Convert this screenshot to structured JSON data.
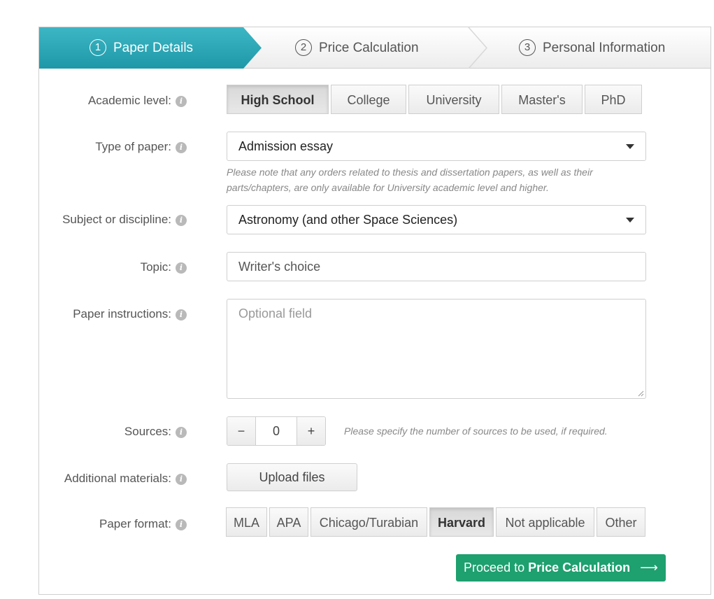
{
  "steps": [
    {
      "num": "1",
      "label": "Paper Details"
    },
    {
      "num": "2",
      "label": "Price Calculation"
    },
    {
      "num": "3",
      "label": "Personal Information"
    }
  ],
  "colors": {
    "active_step": "#29a8b7",
    "primary_button": "#1ea06f"
  },
  "form": {
    "academic_level": {
      "label": "Academic level:",
      "options": [
        "High School",
        "College",
        "University",
        "Master's",
        "PhD"
      ],
      "selected": "High School"
    },
    "type_of_paper": {
      "label": "Type of paper:",
      "value": "Admission essay",
      "note_line1": "Please note that any orders related to thesis and dissertation papers, as well as their",
      "note_line2": "parts/chapters, are only available for University academic level and higher."
    },
    "subject": {
      "label": "Subject or discipline:",
      "value": "Astronomy (and other Space Sciences)"
    },
    "topic": {
      "label": "Topic:",
      "value": "Writer's choice"
    },
    "instructions": {
      "label": "Paper instructions:",
      "placeholder": "Optional field"
    },
    "sources": {
      "label": "Sources:",
      "minus": "−",
      "value": "0",
      "plus": "+",
      "hint": "Please specify the number of sources to be used, if required."
    },
    "materials": {
      "label": "Additional materials:",
      "button": "Upload files"
    },
    "paper_format": {
      "label": "Paper format:",
      "options": [
        "MLA",
        "APA",
        "Chicago/Turabian",
        "Harvard",
        "Not applicable",
        "Other"
      ],
      "selected": "Harvard"
    }
  },
  "proceed": {
    "prefix": "Proceed to ",
    "bold": "Price Calculation",
    "arrow": "⟶"
  },
  "icons": {
    "info": "info-icon",
    "caret": "caret-down-icon"
  }
}
